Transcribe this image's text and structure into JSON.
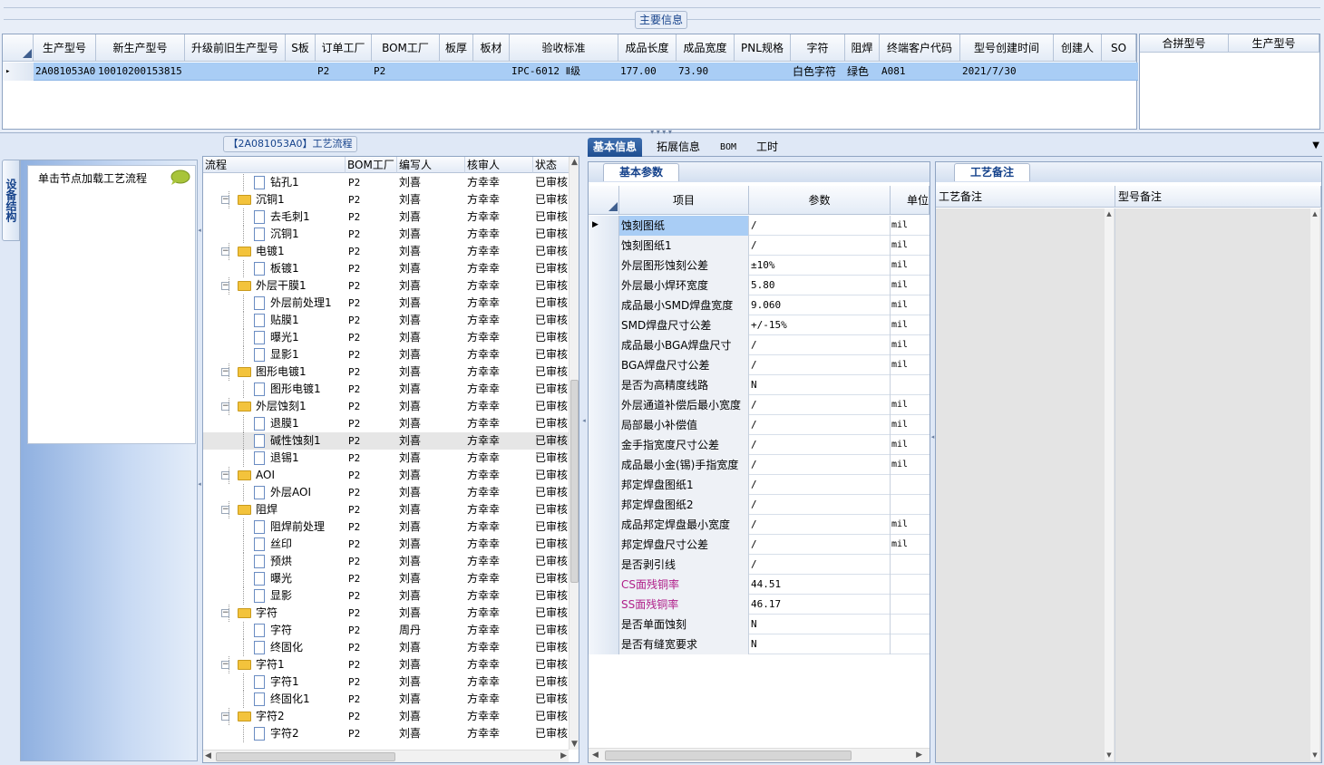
{
  "main_info": {
    "title": "主要信息",
    "columns": [
      "生产型号",
      "新生产型号",
      "升级前旧生产型号",
      "S板",
      "订单工厂",
      "BOM工厂",
      "板厚",
      "板材",
      "验收标准",
      "成品长度",
      "成品宽度",
      "PNL规格",
      "字符",
      "阻焊",
      "终端客户代码",
      "型号创建时间",
      "创建人",
      "SO"
    ],
    "row": {
      "marker": "▸",
      "production_model": "2A081053A0",
      "new_production_model": "10010200153815",
      "old_model": "",
      "s_board": "",
      "order_factory": "P2",
      "bom_factory": "P2",
      "thickness": "",
      "material": "",
      "acceptance_standard": "IPC-6012 Ⅱ级",
      "length": "177.00",
      "width": "73.90",
      "pnl": "",
      "character": "白色字符",
      "solder_mask": "绿色",
      "end_customer": "A081",
      "created_time": "2021/7/30",
      "creator": "",
      "so": ""
    },
    "merge_columns": [
      "合拼型号",
      "生产型号"
    ]
  },
  "left_panel": {
    "side_tab": "设备结构",
    "hint": "单击节点加载工艺流程"
  },
  "process_tree": {
    "title": "【2A081053A0】工艺流程",
    "columns": [
      "流程",
      "BOM工厂",
      "编写人",
      "核审人",
      "状态"
    ],
    "rows": [
      {
        "level": 1,
        "type": "doc",
        "name": "钻孔1",
        "bom": "P2",
        "writer": "刘喜",
        "reviewer": "方幸幸",
        "status": "已审核"
      },
      {
        "level": 0,
        "type": "folder",
        "name": "沉铜1",
        "bom": "P2",
        "writer": "刘喜",
        "reviewer": "方幸幸",
        "status": "已审核"
      },
      {
        "level": 1,
        "type": "doc",
        "name": "去毛刺1",
        "bom": "P2",
        "writer": "刘喜",
        "reviewer": "方幸幸",
        "status": "已审核"
      },
      {
        "level": 1,
        "type": "doc",
        "name": "沉铜1",
        "bom": "P2",
        "writer": "刘喜",
        "reviewer": "方幸幸",
        "status": "已审核"
      },
      {
        "level": 0,
        "type": "folder",
        "name": "电镀1",
        "bom": "P2",
        "writer": "刘喜",
        "reviewer": "方幸幸",
        "status": "已审核"
      },
      {
        "level": 1,
        "type": "doc",
        "name": "板镀1",
        "bom": "P2",
        "writer": "刘喜",
        "reviewer": "方幸幸",
        "status": "已审核"
      },
      {
        "level": 0,
        "type": "folder",
        "name": "外层干膜1",
        "bom": "P2",
        "writer": "刘喜",
        "reviewer": "方幸幸",
        "status": "已审核"
      },
      {
        "level": 1,
        "type": "doc",
        "name": "外层前处理1",
        "bom": "P2",
        "writer": "刘喜",
        "reviewer": "方幸幸",
        "status": "已审核"
      },
      {
        "level": 1,
        "type": "doc",
        "name": "贴膜1",
        "bom": "P2",
        "writer": "刘喜",
        "reviewer": "方幸幸",
        "status": "已审核"
      },
      {
        "level": 1,
        "type": "doc",
        "name": "曝光1",
        "bom": "P2",
        "writer": "刘喜",
        "reviewer": "方幸幸",
        "status": "已审核"
      },
      {
        "level": 1,
        "type": "doc",
        "name": "显影1",
        "bom": "P2",
        "writer": "刘喜",
        "reviewer": "方幸幸",
        "status": "已审核"
      },
      {
        "level": 0,
        "type": "folder",
        "name": "图形电镀1",
        "bom": "P2",
        "writer": "刘喜",
        "reviewer": "方幸幸",
        "status": "已审核"
      },
      {
        "level": 1,
        "type": "doc",
        "name": "图形电镀1",
        "bom": "P2",
        "writer": "刘喜",
        "reviewer": "方幸幸",
        "status": "已审核"
      },
      {
        "level": 0,
        "type": "folder",
        "name": "外层蚀刻1",
        "bom": "P2",
        "writer": "刘喜",
        "reviewer": "方幸幸",
        "status": "已审核"
      },
      {
        "level": 1,
        "type": "doc",
        "name": "退膜1",
        "bom": "P2",
        "writer": "刘喜",
        "reviewer": "方幸幸",
        "status": "已审核"
      },
      {
        "level": 1,
        "type": "doc",
        "name": "碱性蚀刻1",
        "bom": "P2",
        "writer": "刘喜",
        "reviewer": "方幸幸",
        "status": "已审核",
        "selected": true
      },
      {
        "level": 1,
        "type": "doc",
        "name": "退锡1",
        "bom": "P2",
        "writer": "刘喜",
        "reviewer": "方幸幸",
        "status": "已审核"
      },
      {
        "level": 0,
        "type": "folder",
        "name": "AOI",
        "bom": "P2",
        "writer": "刘喜",
        "reviewer": "方幸幸",
        "status": "已审核"
      },
      {
        "level": 1,
        "type": "doc",
        "name": "外层AOI",
        "bom": "P2",
        "writer": "刘喜",
        "reviewer": "方幸幸",
        "status": "已审核"
      },
      {
        "level": 0,
        "type": "folder",
        "name": "阻焊",
        "bom": "P2",
        "writer": "刘喜",
        "reviewer": "方幸幸",
        "status": "已审核"
      },
      {
        "level": 1,
        "type": "doc",
        "name": "阻焊前处理",
        "bom": "P2",
        "writer": "刘喜",
        "reviewer": "方幸幸",
        "status": "已审核"
      },
      {
        "level": 1,
        "type": "doc",
        "name": "丝印",
        "bom": "P2",
        "writer": "刘喜",
        "reviewer": "方幸幸",
        "status": "已审核"
      },
      {
        "level": 1,
        "type": "doc",
        "name": "预烘",
        "bom": "P2",
        "writer": "刘喜",
        "reviewer": "方幸幸",
        "status": "已审核"
      },
      {
        "level": 1,
        "type": "doc",
        "name": "曝光",
        "bom": "P2",
        "writer": "刘喜",
        "reviewer": "方幸幸",
        "status": "已审核"
      },
      {
        "level": 1,
        "type": "doc",
        "name": "显影",
        "bom": "P2",
        "writer": "刘喜",
        "reviewer": "方幸幸",
        "status": "已审核"
      },
      {
        "level": 0,
        "type": "folder",
        "name": "字符",
        "bom": "P2",
        "writer": "刘喜",
        "reviewer": "方幸幸",
        "status": "已审核"
      },
      {
        "level": 1,
        "type": "doc",
        "name": "字符",
        "bom": "P2",
        "writer": "周丹",
        "reviewer": "方幸幸",
        "status": "已审核"
      },
      {
        "level": 1,
        "type": "doc",
        "name": "终固化",
        "bom": "P2",
        "writer": "刘喜",
        "reviewer": "方幸幸",
        "status": "已审核"
      },
      {
        "level": 0,
        "type": "folder",
        "name": "字符1",
        "bom": "P2",
        "writer": "刘喜",
        "reviewer": "方幸幸",
        "status": "已审核"
      },
      {
        "level": 1,
        "type": "doc",
        "name": "字符1",
        "bom": "P2",
        "writer": "刘喜",
        "reviewer": "方幸幸",
        "status": "已审核"
      },
      {
        "level": 1,
        "type": "doc",
        "name": "终固化1",
        "bom": "P2",
        "writer": "刘喜",
        "reviewer": "方幸幸",
        "status": "已审核"
      },
      {
        "level": 0,
        "type": "folder",
        "name": "字符2",
        "bom": "P2",
        "writer": "刘喜",
        "reviewer": "方幸幸",
        "status": "已审核"
      },
      {
        "level": 1,
        "type": "doc",
        "name": "字符2",
        "bom": "P2",
        "writer": "刘喜",
        "reviewer": "方幸幸",
        "status": "已审核"
      }
    ]
  },
  "tabs": [
    "基本信息",
    "拓展信息",
    "BOM",
    "工时"
  ],
  "basic_params": {
    "title": "基本参数",
    "columns": [
      "项目",
      "参数",
      "单位"
    ],
    "rows": [
      {
        "item": "蚀刻图纸",
        "value": "/",
        "unit": "mil"
      },
      {
        "item": "蚀刻图纸1",
        "value": "/",
        "unit": "mil"
      },
      {
        "item": "外层图形蚀刻公差",
        "value": "±10%",
        "unit": "mil"
      },
      {
        "item": "外层最小焊环宽度",
        "value": "5.80",
        "unit": "mil"
      },
      {
        "item": "成品最小SMD焊盘宽度",
        "value": "9.060",
        "unit": "mil"
      },
      {
        "item": "SMD焊盘尺寸公差",
        "value": "+/-15%",
        "unit": "mil"
      },
      {
        "item": "成品最小BGA焊盘尺寸",
        "value": "/",
        "unit": "mil"
      },
      {
        "item": "BGA焊盘尺寸公差",
        "value": "/",
        "unit": "mil"
      },
      {
        "item": "是否为高精度线路",
        "value": "N",
        "unit": ""
      },
      {
        "item": "外层通道补偿后最小宽度",
        "value": "/",
        "unit": "mil"
      },
      {
        "item": "局部最小补偿值",
        "value": "/",
        "unit": "mil"
      },
      {
        "item": "金手指宽度尺寸公差",
        "value": "/",
        "unit": "mil"
      },
      {
        "item": "成品最小金(锡)手指宽度",
        "value": "/",
        "unit": "mil"
      },
      {
        "item": "邦定焊盘图纸1",
        "value": "/",
        "unit": ""
      },
      {
        "item": "邦定焊盘图纸2",
        "value": "/",
        "unit": ""
      },
      {
        "item": "成品邦定焊盘最小宽度",
        "value": "/",
        "unit": "mil"
      },
      {
        "item": "邦定焊盘尺寸公差",
        "value": "/",
        "unit": "mil"
      },
      {
        "item": "是否剥引线",
        "value": "/",
        "unit": ""
      },
      {
        "item": "CS面残铜率",
        "value": "44.51",
        "unit": "",
        "highlight": true
      },
      {
        "item": "SS面残铜率",
        "value": "46.17",
        "unit": "",
        "highlight": true
      },
      {
        "item": "是否单面蚀刻",
        "value": "N",
        "unit": ""
      },
      {
        "item": "是否有缝宽要求",
        "value": "N",
        "unit": ""
      }
    ]
  },
  "process_notes": {
    "title": "工艺备注",
    "columns": [
      "工艺备注",
      "型号备注"
    ]
  },
  "colors": {
    "highlight_text": "#b0208a",
    "selected_row": "#a9cdf5",
    "accent": "#15428b"
  }
}
